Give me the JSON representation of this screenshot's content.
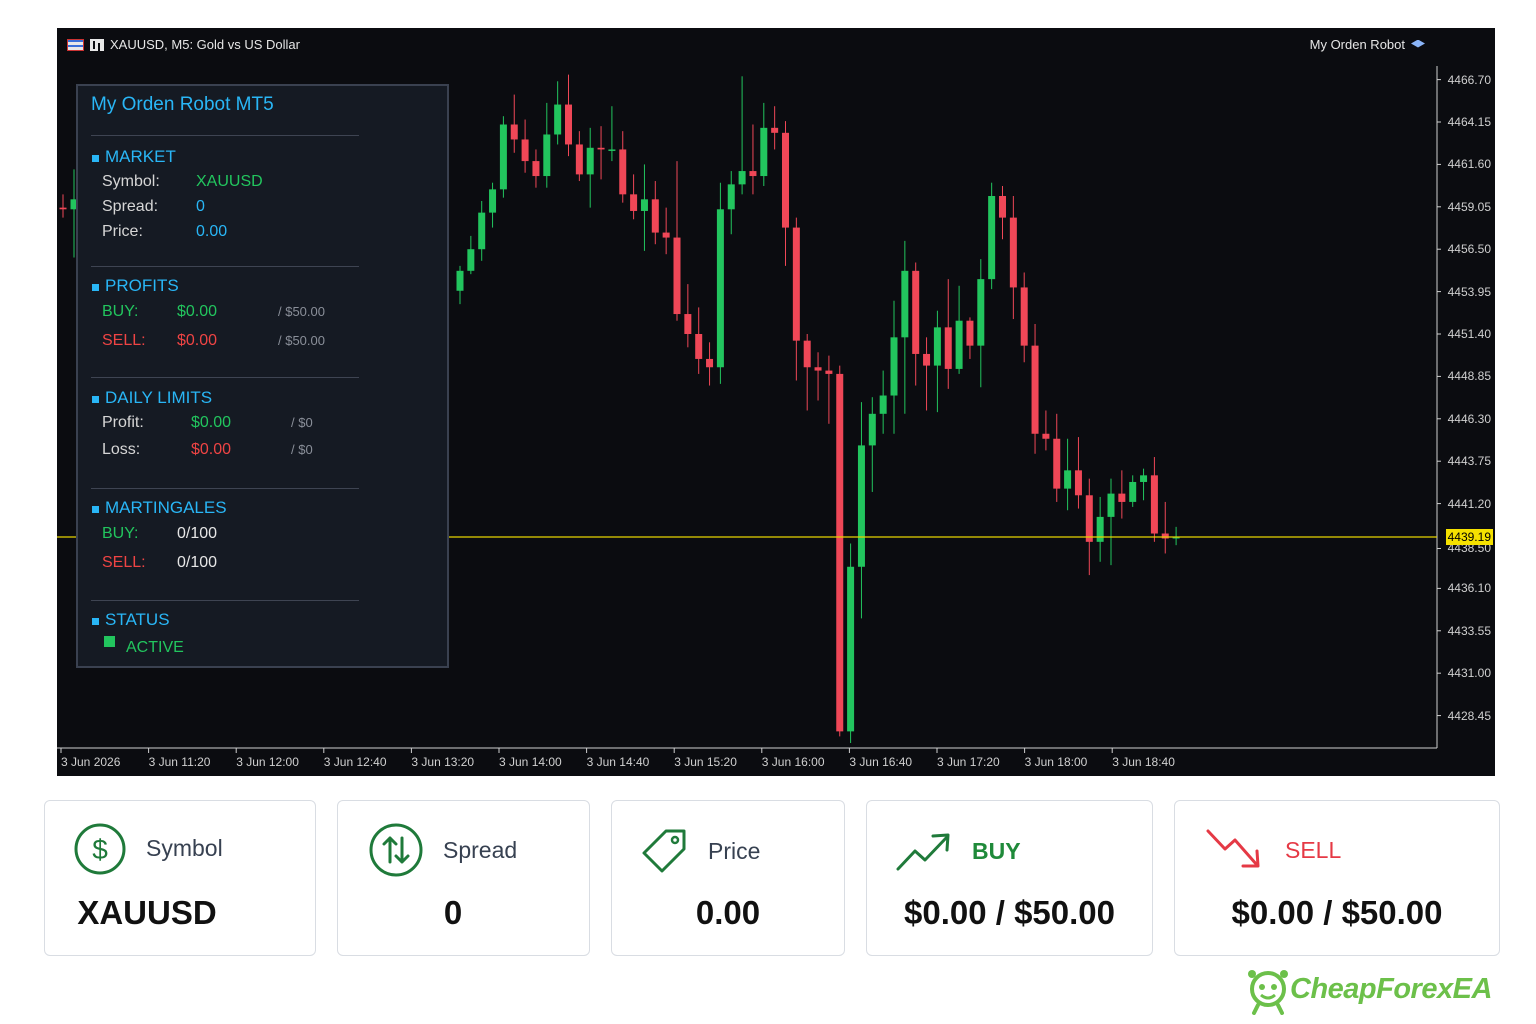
{
  "window": {
    "title": "XAUUSD, M5:  Gold vs US Dollar",
    "expert_name": "My Orden Robot"
  },
  "panel": {
    "title": "My Orden Robot MT5",
    "market": {
      "header": "MARKET",
      "symbol_label": "Symbol:",
      "symbol": "XAUUSD",
      "spread_label": "Spread:",
      "spread": "0",
      "price_label": "Price:",
      "price": "0.00"
    },
    "profits": {
      "header": "PROFITS",
      "buy_label": "BUY:",
      "buy": "$0.00",
      "buy_limit": "/ $50.00",
      "sell_label": "SELL:",
      "sell": "$0.00",
      "sell_limit": "/ $50.00"
    },
    "daily_limits": {
      "header": "DAILY LIMITS",
      "profit_label": "Profit:",
      "profit": "$0.00",
      "profit_limit": "/ $0",
      "loss_label": "Loss:",
      "loss": "$0.00",
      "loss_limit": "/ $0"
    },
    "martingales": {
      "header": "MARTINGALES",
      "buy_label": "BUY:",
      "buy": "0/100",
      "sell_label": "SELL:",
      "sell": "0/100"
    },
    "status": {
      "header": "STATUS",
      "value": "ACTIVE"
    }
  },
  "colors": {
    "bull": "#22c55e",
    "bear": "#ef4757",
    "accent": "#29b6f6",
    "current_price_line": "#e6d400"
  },
  "chart_data": {
    "type": "candlestick",
    "symbol": "XAUUSD",
    "timeframe": "M5",
    "current_price": "4439.19",
    "ylim": [
      4426.5,
      4468.0
    ],
    "y_ticks": [
      "4466.70",
      "4464.15",
      "4461.60",
      "4459.05",
      "4456.50",
      "4453.95",
      "4451.40",
      "4448.85",
      "4446.30",
      "4443.75",
      "4441.20",
      "4438.50",
      "4436.10",
      "4433.55",
      "4431.00",
      "4428.45"
    ],
    "x_ticks": [
      "3 Jun 2026",
      "3 Jun 11:20",
      "3 Jun 12:00",
      "3 Jun 12:40",
      "3 Jun 13:20",
      "3 Jun 14:00",
      "3 Jun 14:40",
      "3 Jun 15:20",
      "3 Jun 16:00",
      "3 Jun 16:40",
      "3 Jun 17:20",
      "3 Jun 18:00",
      "3 Jun 18:40"
    ],
    "candles": [
      [
        4459.0,
        4459.8,
        4458.4,
        4458.9
      ],
      [
        4458.9,
        4461.3,
        4456.0,
        4459.5
      ],
      [
        4454.0,
        4455.5,
        4453.2,
        4455.2
      ],
      [
        4455.2,
        4457.3,
        4455.0,
        4456.5
      ],
      [
        4456.5,
        4459.4,
        4455.8,
        4458.7
      ],
      [
        4458.7,
        4460.5,
        4457.8,
        4460.1
      ],
      [
        4460.1,
        4464.5,
        4459.6,
        4464.0
      ],
      [
        4464.0,
        4465.8,
        4462.3,
        4463.1
      ],
      [
        4463.1,
        4464.3,
        4461.1,
        4461.8
      ],
      [
        4461.8,
        4462.5,
        4460.2,
        4460.9
      ],
      [
        4460.9,
        4465.3,
        4460.2,
        4463.4
      ],
      [
        4463.4,
        4466.6,
        4462.8,
        4465.2
      ],
      [
        4465.2,
        4467.0,
        4462.1,
        4462.8
      ],
      [
        4462.8,
        4463.6,
        4460.6,
        4461.0
      ],
      [
        4461.0,
        4463.8,
        4459.0,
        4462.6
      ],
      [
        4462.6,
        4463.9,
        4460.7,
        4462.5
      ],
      [
        4462.5,
        4465.1,
        4461.8,
        4462.5
      ],
      [
        4462.5,
        4463.6,
        4459.3,
        4459.8
      ],
      [
        4459.8,
        4461.0,
        4458.3,
        4458.8
      ],
      [
        4458.8,
        4461.6,
        4456.4,
        4459.5
      ],
      [
        4459.5,
        4460.6,
        4456.8,
        4457.5
      ],
      [
        4457.5,
        4459.0,
        4456.2,
        4457.2
      ],
      [
        4457.2,
        4461.8,
        4452.2,
        4452.6
      ],
      [
        4452.6,
        4454.4,
        4450.6,
        4451.4
      ],
      [
        4451.4,
        4453.0,
        4449.0,
        4449.9
      ],
      [
        4449.9,
        4450.9,
        4448.3,
        4449.4
      ],
      [
        4449.4,
        4460.5,
        4448.4,
        4458.9
      ],
      [
        4458.9,
        4461.2,
        4457.4,
        4460.4
      ],
      [
        4460.4,
        4466.9,
        4459.8,
        4461.2
      ],
      [
        4461.2,
        4464.0,
        4459.8,
        4460.9
      ],
      [
        4460.9,
        4465.3,
        4460.3,
        4463.8
      ],
      [
        4463.8,
        4465.1,
        4462.5,
        4463.5
      ],
      [
        4463.5,
        4464.2,
        4455.5,
        4457.8
      ],
      [
        4457.8,
        4458.4,
        4448.6,
        4451.0
      ],
      [
        4451.0,
        4451.4,
        4446.8,
        4449.4
      ],
      [
        4449.4,
        4450.3,
        4447.4,
        4449.2
      ],
      [
        4449.2,
        4450.1,
        4446.0,
        4449.0
      ],
      [
        4449.0,
        4449.5,
        4427.2,
        4427.5
      ],
      [
        4427.5,
        4438.8,
        4426.8,
        4437.4
      ],
      [
        4437.4,
        4447.3,
        4434.3,
        4444.7
      ],
      [
        4444.7,
        4447.6,
        4441.9,
        4446.6
      ],
      [
        4446.6,
        4449.2,
        4445.4,
        4447.7
      ],
      [
        4447.7,
        4453.4,
        4445.4,
        4451.2
      ],
      [
        4451.2,
        4457.0,
        4446.6,
        4455.2
      ],
      [
        4455.2,
        4455.7,
        4448.3,
        4450.2
      ],
      [
        4450.2,
        4451.2,
        4446.8,
        4449.5
      ],
      [
        4449.5,
        4452.8,
        4446.7,
        4451.8
      ],
      [
        4451.8,
        4454.7,
        4448.1,
        4449.3
      ],
      [
        4449.3,
        4454.3,
        4449.0,
        4452.2
      ],
      [
        4452.2,
        4452.4,
        4449.9,
        4450.7
      ],
      [
        4450.7,
        4455.9,
        4448.2,
        4454.7
      ],
      [
        4454.7,
        4460.5,
        4454.1,
        4459.7
      ],
      [
        4459.7,
        4460.3,
        4457.1,
        4458.4
      ],
      [
        4458.4,
        4459.7,
        4452.3,
        4454.2
      ],
      [
        4454.2,
        4455.1,
        4449.7,
        4450.7
      ],
      [
        4450.7,
        4452.0,
        4444.2,
        4445.4
      ],
      [
        4445.4,
        4446.8,
        4444.4,
        4445.1
      ],
      [
        4445.1,
        4446.6,
        4441.3,
        4442.1
      ],
      [
        4442.1,
        4445.1,
        4440.8,
        4443.2
      ],
      [
        4443.2,
        4445.2,
        4440.9,
        4441.7
      ],
      [
        4441.7,
        4442.7,
        4436.9,
        4438.9
      ],
      [
        4438.9,
        4441.6,
        4437.7,
        4440.4
      ],
      [
        4440.4,
        4442.7,
        4437.5,
        4441.8
      ],
      [
        4441.8,
        4443.2,
        4440.3,
        4441.3
      ],
      [
        4441.3,
        4442.9,
        4441.0,
        4442.5
      ],
      [
        4442.5,
        4443.3,
        4441.4,
        4442.9
      ],
      [
        4442.9,
        4444.0,
        4438.9,
        4439.4
      ],
      [
        4439.4,
        4441.3,
        4438.2,
        4439.1
      ],
      [
        4439.1,
        4439.8,
        4438.7,
        4439.19
      ]
    ]
  },
  "cards": [
    {
      "label": "Symbol",
      "value": "XAUUSD"
    },
    {
      "label": "Spread",
      "value": "0"
    },
    {
      "label": "Price",
      "value": "0.00"
    },
    {
      "label": "BUY",
      "value": "$0.00 / $50.00"
    },
    {
      "label": "SELL",
      "value": "$0.00 / $50.00"
    }
  ],
  "logo": {
    "text": "CheapForexEA"
  }
}
